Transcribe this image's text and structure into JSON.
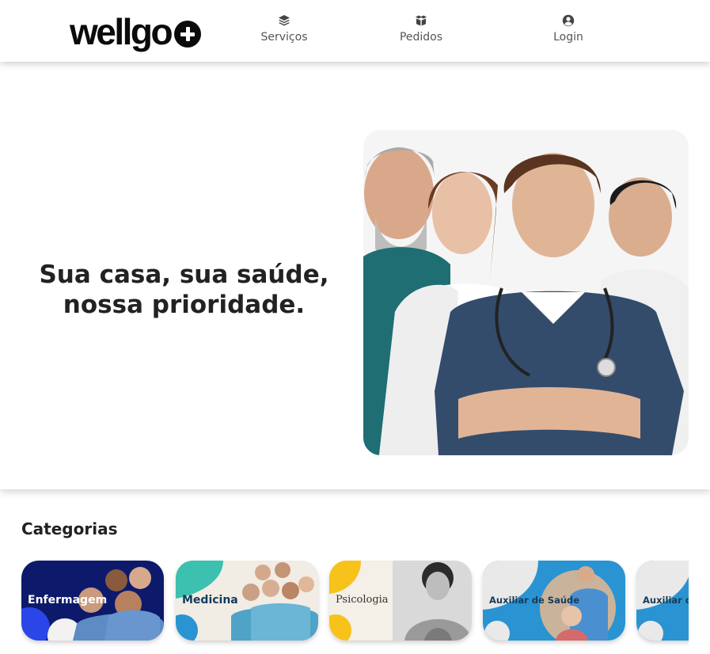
{
  "header": {
    "logo_text": "wellgo",
    "nav": [
      {
        "label": "Serviços",
        "icon": "layers-icon"
      },
      {
        "label": "Pedidos",
        "icon": "box-icon"
      },
      {
        "label": "Login",
        "icon": "user-circle-icon"
      }
    ]
  },
  "hero": {
    "title": "Sua casa, sua saúde, nossa prioridade.",
    "image": "healthcare-team-photo"
  },
  "categories": {
    "title": "Categorias",
    "items": [
      {
        "label": "Enfermagem",
        "image": "nurses-group-photo"
      },
      {
        "label": "Medicina",
        "image": "doctors-group-photo"
      },
      {
        "label": "Psicologia",
        "image": "psychologist-photo"
      },
      {
        "label": "Auxiliar de Saúde",
        "image": "caregiver-elderly-photo"
      },
      {
        "label": "Auxiliar de Saúde",
        "image": "caregiver-photo"
      }
    ]
  },
  "colors": {
    "text": "#222222",
    "nav_text": "#555555",
    "logo": "#0b0b0b",
    "enfermagem_bg": "#0d1a6b",
    "medicina_teal": "#3cc0b0",
    "psicologia_yellow": "#f7c21a",
    "auxiliar_blue": "#2a93d1"
  }
}
